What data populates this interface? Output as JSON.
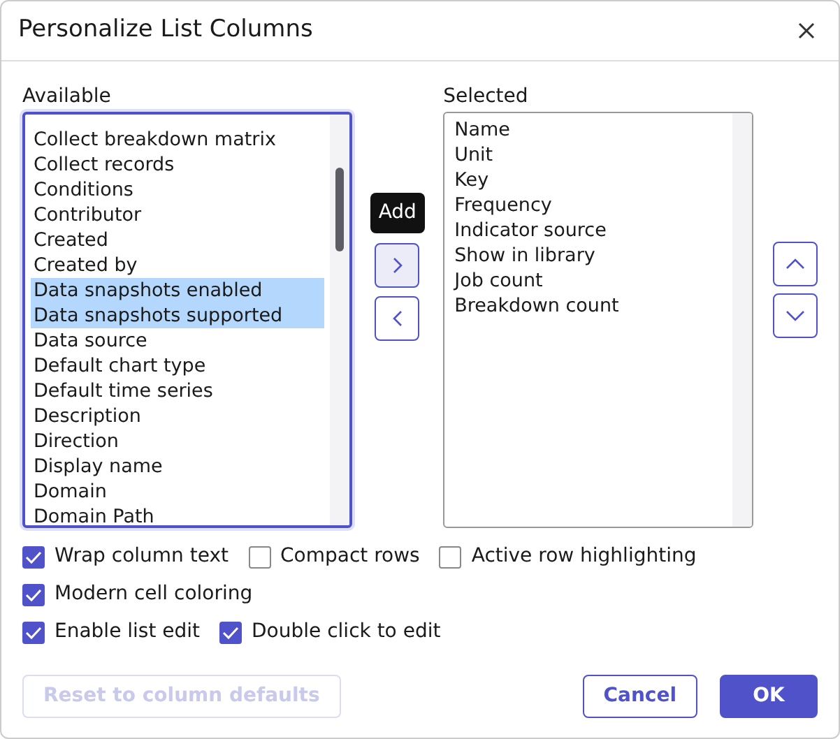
{
  "dialog": {
    "title": "Personalize List Columns"
  },
  "available": {
    "label": "Available",
    "items": [
      {
        "label": "Collect breakdown matrix",
        "selected": false
      },
      {
        "label": "Collect records",
        "selected": false
      },
      {
        "label": "Conditions",
        "selected": false
      },
      {
        "label": "Contributor",
        "selected": false
      },
      {
        "label": "Created",
        "selected": false
      },
      {
        "label": "Created by",
        "selected": false
      },
      {
        "label": "Data snapshots enabled",
        "selected": true
      },
      {
        "label": "Data snapshots supported",
        "selected": true
      },
      {
        "label": "Data source",
        "selected": false
      },
      {
        "label": "Default chart type",
        "selected": false
      },
      {
        "label": "Default time series",
        "selected": false
      },
      {
        "label": "Description",
        "selected": false
      },
      {
        "label": "Direction",
        "selected": false
      },
      {
        "label": "Display name",
        "selected": false
      },
      {
        "label": "Domain",
        "selected": false
      },
      {
        "label": "Domain Path",
        "selected": false
      }
    ]
  },
  "tooltip": "Add",
  "selected": {
    "label": "Selected",
    "items": [
      {
        "label": "Name",
        "selected": false
      },
      {
        "label": "Unit",
        "selected": false
      },
      {
        "label": "Key",
        "selected": false
      },
      {
        "label": "Frequency",
        "selected": false
      },
      {
        "label": "Indicator source",
        "selected": false
      },
      {
        "label": "Show in library",
        "selected": false
      },
      {
        "label": "Job count",
        "selected": false
      },
      {
        "label": "Breakdown count",
        "selected": false
      }
    ]
  },
  "options": [
    [
      {
        "label": "Wrap column text",
        "checked": true
      },
      {
        "label": "Compact rows",
        "checked": false
      },
      {
        "label": "Active row highlighting",
        "checked": false
      }
    ],
    [
      {
        "label": "Modern cell coloring",
        "checked": true
      }
    ],
    [
      {
        "label": "Enable list edit",
        "checked": true
      },
      {
        "label": "Double click to edit",
        "checked": true
      }
    ]
  ],
  "footer": {
    "reset": {
      "label": "Reset to column defaults",
      "disabled": true
    },
    "cancel": "Cancel",
    "ok": "OK"
  }
}
